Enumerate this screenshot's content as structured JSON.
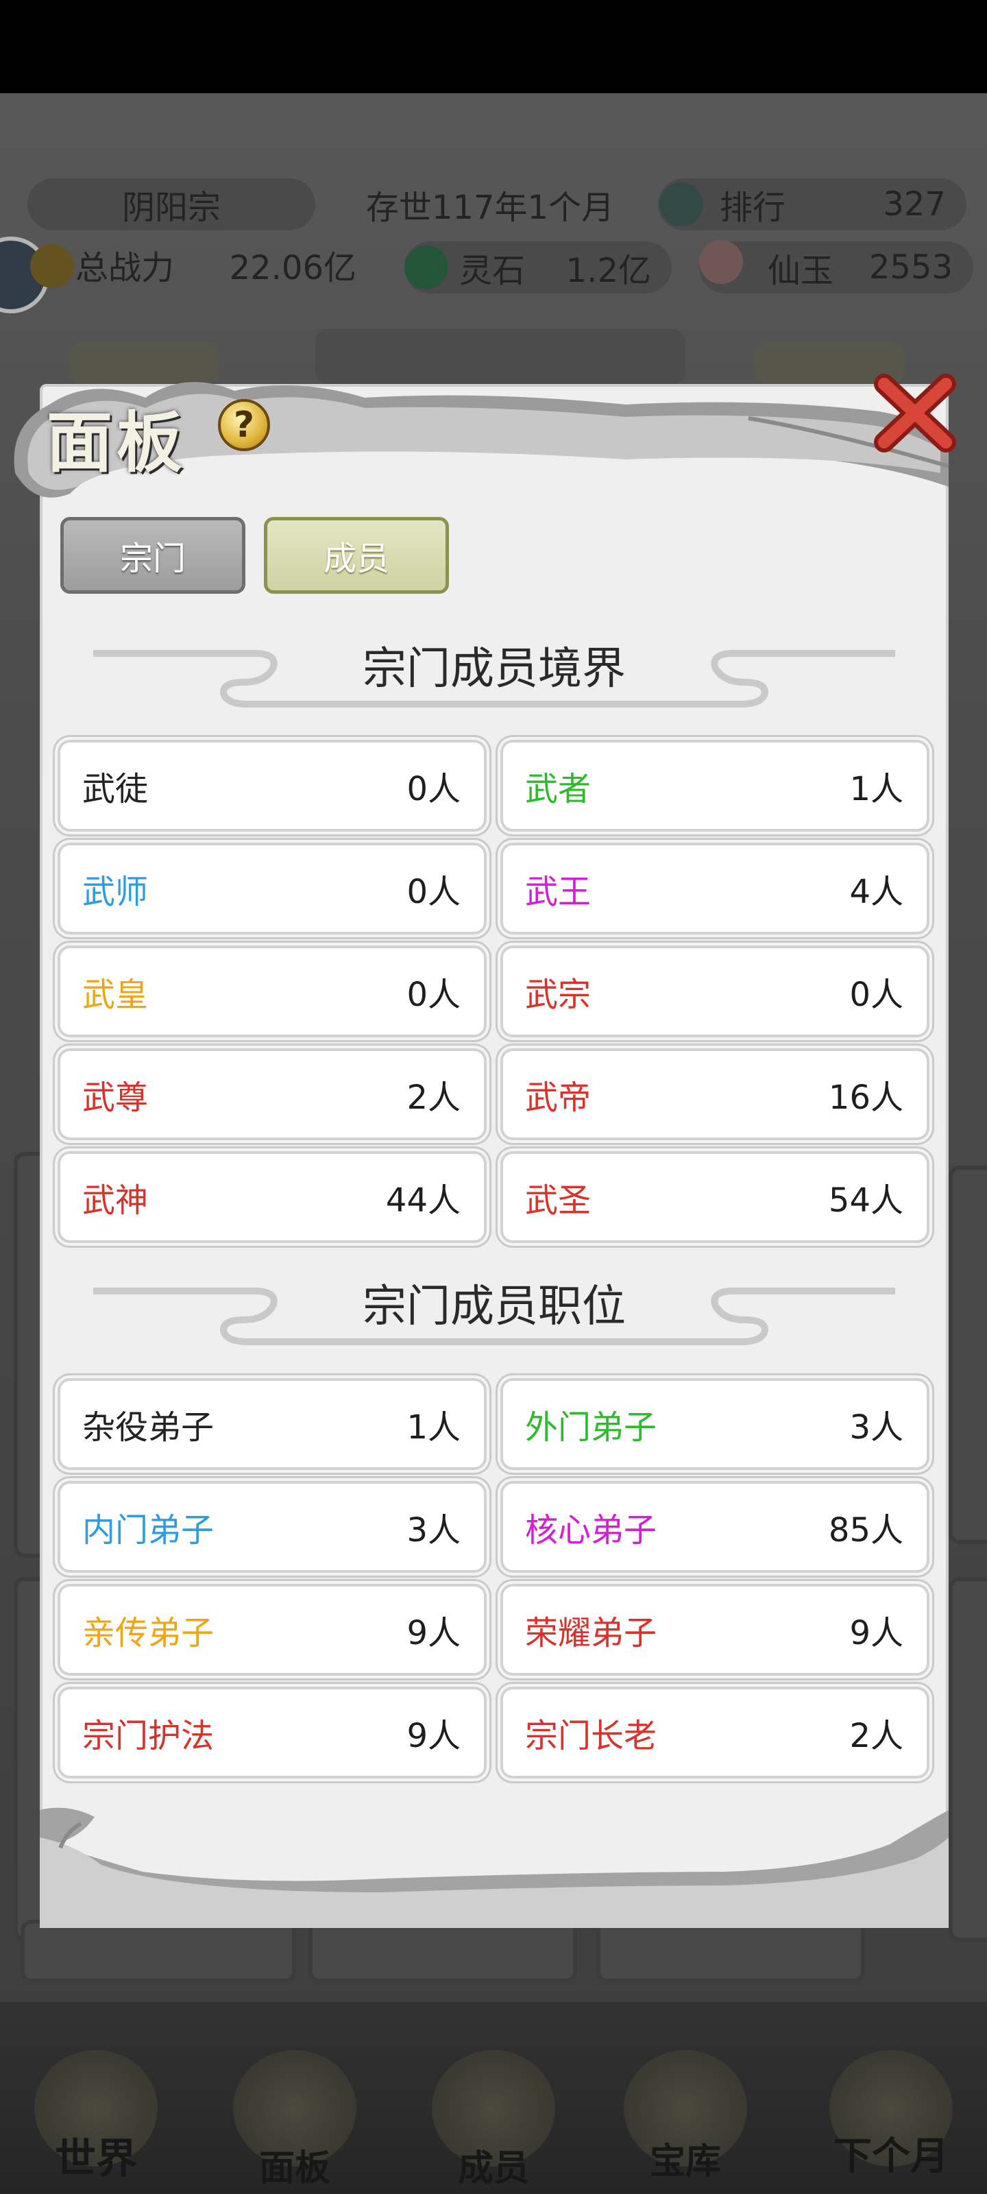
{
  "header": {
    "sect_name": "阴阳宗",
    "age": "存世117年1个月",
    "rank_label": "排行",
    "rank_value": "327",
    "power_label": "总战力",
    "power_value": "22.06亿",
    "stone_label": "灵石",
    "stone_value": "1.2亿",
    "jade_label": "仙玉",
    "jade_value": "2553"
  },
  "panel": {
    "title": "面板",
    "help": "?",
    "tabs": [
      {
        "label": "宗门"
      },
      {
        "label": "成员"
      }
    ],
    "realm_title": "宗门成员境界",
    "realms": [
      {
        "name": "武徒",
        "count": "0人",
        "color": "#222222"
      },
      {
        "name": "武者",
        "count": "1人",
        "color": "#2dbb2d"
      },
      {
        "name": "武师",
        "count": "0人",
        "color": "#2f9be0"
      },
      {
        "name": "武王",
        "count": "4人",
        "color": "#d51dd5"
      },
      {
        "name": "武皇",
        "count": "0人",
        "color": "#f0a516"
      },
      {
        "name": "武宗",
        "count": "0人",
        "color": "#d8322a"
      },
      {
        "name": "武尊",
        "count": "2人",
        "color": "#d8322a"
      },
      {
        "name": "武帝",
        "count": "16人",
        "color": "#d8322a"
      },
      {
        "name": "武神",
        "count": "44人",
        "color": "#d8322a"
      },
      {
        "name": "武圣",
        "count": "54人",
        "color": "#d8322a"
      }
    ],
    "position_title": "宗门成员职位",
    "positions": [
      {
        "name": "杂役弟子",
        "count": "1人",
        "color": "#222222"
      },
      {
        "name": "外门弟子",
        "count": "3人",
        "color": "#2dbb2d"
      },
      {
        "name": "内门弟子",
        "count": "3人",
        "color": "#2f9be0"
      },
      {
        "name": "核心弟子",
        "count": "85人",
        "color": "#d51dd5"
      },
      {
        "name": "亲传弟子",
        "count": "9人",
        "color": "#f0a516"
      },
      {
        "name": "荣耀弟子",
        "count": "9人",
        "color": "#d8322a"
      },
      {
        "name": "宗门护法",
        "count": "9人",
        "color": "#d8322a"
      },
      {
        "name": "宗门长老",
        "count": "2人",
        "color": "#d8322a"
      }
    ]
  },
  "nav": {
    "items": [
      {
        "label": "世界"
      },
      {
        "label": "面板"
      },
      {
        "label": "成员"
      },
      {
        "label": "宝库"
      },
      {
        "label": "下个月"
      }
    ]
  }
}
